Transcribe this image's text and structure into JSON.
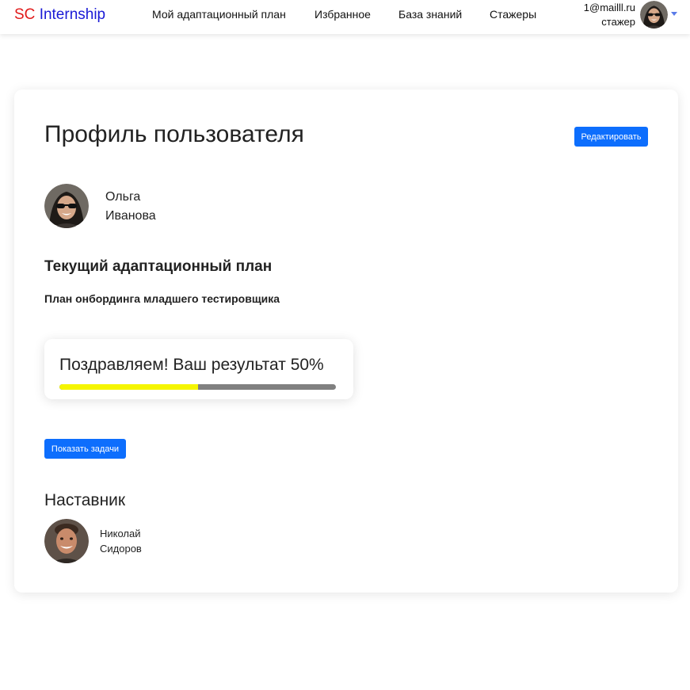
{
  "brand": {
    "part1": "SC",
    "part2": "Internship"
  },
  "nav": {
    "items": [
      {
        "label": "Мой адаптационный план"
      },
      {
        "label": "Избранное"
      },
      {
        "label": "База знаний"
      },
      {
        "label": "Стажеры"
      }
    ]
  },
  "user": {
    "email": "1@mailll.ru",
    "role": "стажер",
    "avatar_icon": "user-avatar-photo"
  },
  "profile": {
    "title": "Профиль пользователя",
    "edit_label": "Редактировать",
    "first_name": "Ольга",
    "last_name": "Иванова"
  },
  "plan": {
    "section_title": "Текущий адаптационный план",
    "name": "План онбординга младшего тестировщика",
    "result_text": "Поздравляем! Ваш результат 50%",
    "progress": 0.5,
    "show_tasks_label": "Показать задачи"
  },
  "mentor": {
    "title": "Наставник",
    "first_name": "Николай",
    "last_name": "Сидоров"
  },
  "colors": {
    "brand_red": "#e11a1a",
    "brand_blue": "#1a1ad6",
    "primary": "#0d6efd",
    "progress_fill": "#f5f500",
    "progress_track": "#808080"
  }
}
